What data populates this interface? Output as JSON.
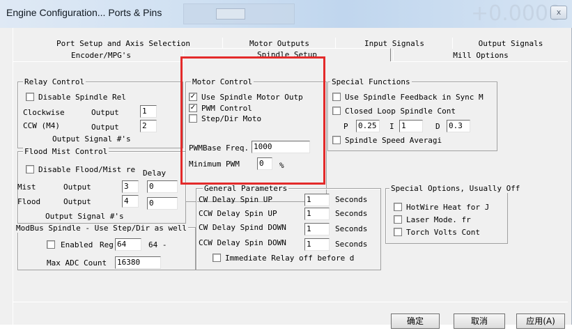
{
  "window": {
    "title": "Engine Configuration... Ports & Pins",
    "background_value": "+0.0000",
    "close_symbol": "x"
  },
  "tabs": {
    "row1": [
      "Port Setup and Axis Selection",
      "Motor Outputs",
      "Input Signals",
      "Output Signals"
    ],
    "row2": [
      "Encoder/MPG's",
      "Spindle Setup",
      "Mill Options"
    ],
    "active": "Spindle Setup"
  },
  "relay_control": {
    "title": "Relay Control",
    "disable_label": "Disable Spindle Rel",
    "disable_checked": false,
    "clockwise_label": "Clockwise",
    "clockwise_output_label": "Output",
    "clockwise_value": "1",
    "ccw_label": "CCW (M4)",
    "ccw_output_label": "Output",
    "ccw_value": "2",
    "footer": "Output Signal #'s"
  },
  "motor_control": {
    "title": "Motor Control",
    "use_spindle_label": "Use Spindle Motor Outp",
    "use_spindle_checked": true,
    "pwm_label": "PWM Control",
    "pwm_checked": true,
    "stepdir_label": "Step/Dir Moto",
    "stepdir_checked": false,
    "pwm_base_label": "PWMBase Freq.",
    "pwm_base_value": "1000",
    "min_pwm_label": "Minimum PWM",
    "min_pwm_value": "0",
    "min_pwm_unit": "%"
  },
  "special_functions": {
    "title": "Special Functions",
    "feedback_label": "Use Spindle Feedback in Sync M",
    "feedback_checked": false,
    "closed_loop_label": "Closed Loop Spindle Cont",
    "closed_loop_checked": false,
    "p_label": "P",
    "p_value": "0.25",
    "i_label": "I",
    "i_value": "1",
    "d_label": "D",
    "d_value": "0.3",
    "averaging_label": "Spindle Speed Averagi",
    "averaging_checked": false
  },
  "flood_mist": {
    "title": "Flood Mist Control",
    "disable_label": "Disable Flood/Mist re",
    "disable_checked": false,
    "delay_label": "Delay",
    "mist_label": "Mist",
    "mist_output_label": "Output",
    "mist_output_value": "3",
    "mist_delay_value": "0",
    "flood_label": "Flood",
    "flood_output_label": "Output",
    "flood_output_value": "4",
    "flood_delay_value": "0",
    "footer": "Output Signal #'s"
  },
  "general_parameters": {
    "title": "General Parameters",
    "rows": [
      {
        "label": "CW Delay Spin UP",
        "value": "1",
        "unit": "Seconds"
      },
      {
        "label": "CCW Delay Spin UP",
        "value": "1",
        "unit": "Seconds"
      },
      {
        "label": "CW Delay Spind DOWN",
        "value": "1",
        "unit": "Seconds"
      },
      {
        "label": "CCW Delay Spin DOWN",
        "value": "1",
        "unit": "Seconds"
      }
    ],
    "immediate_label": "Immediate Relay off before d",
    "immediate_checked": false
  },
  "special_options": {
    "title": "Special Options, Usually Off",
    "hotwire_label": "HotWire Heat for J",
    "hotwire_checked": false,
    "laser_label": "Laser Mode. fr",
    "laser_checked": false,
    "torch_label": "Torch Volts Cont",
    "torch_checked": false
  },
  "modbus": {
    "title": "ModBus Spindle - Use Step/Dir as well",
    "enabled_label": "Enabled",
    "enabled_checked": false,
    "reg_label": "Reg",
    "reg_value": "64",
    "reg_suffix": "64 -",
    "max_adc_label": "Max ADC Count",
    "max_adc_value": "16380"
  },
  "buttons": {
    "ok": "确定",
    "cancel": "取消",
    "apply": "应用(A)"
  },
  "colors": {
    "highlight": "#e32a2a"
  }
}
